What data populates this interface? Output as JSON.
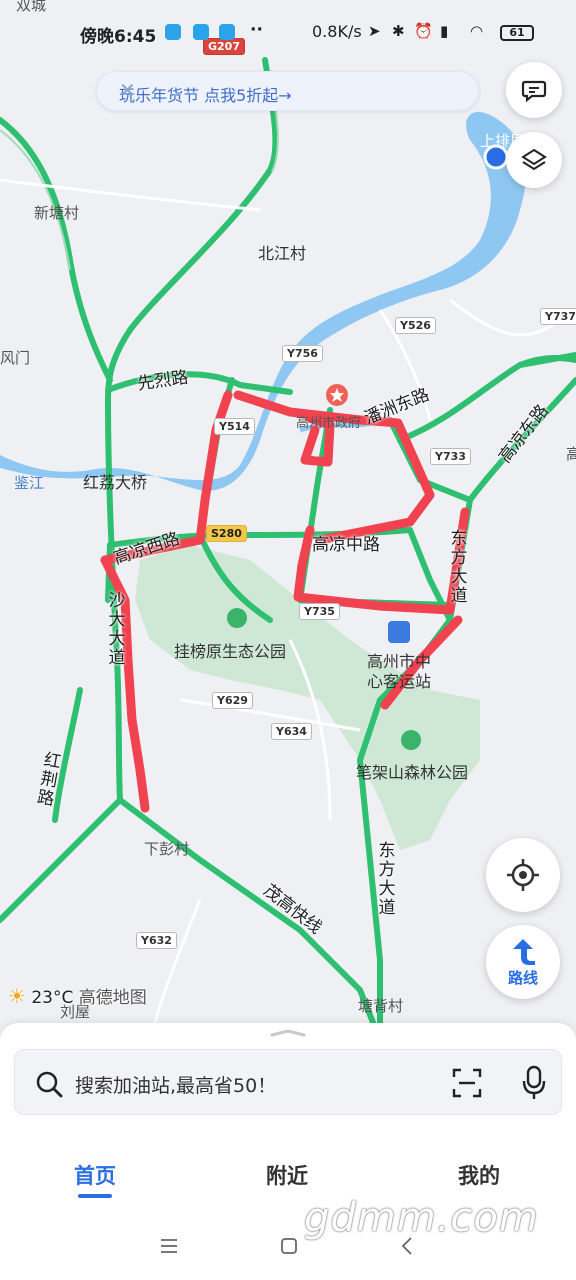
{
  "status_bar": {
    "time": "傍晚6:45",
    "dots": "··",
    "network_speed": "0.8K/s",
    "battery": "61"
  },
  "promo": {
    "text": "玩乐年货节 点我5折起→",
    "close": "✕"
  },
  "map": {
    "top_cut_label": "双城",
    "place_labels": {
      "xintang": "新塘村",
      "beijiang": "北江村",
      "fengmen": "风门",
      "jianjiang": "鉴江",
      "honglijiaqiao": "红荔大桥",
      "guabangyuan": "挂榜原生态公园",
      "gaozhou_bus_1": "高州市中",
      "gaozhou_bus_2": "心客运站",
      "bijiashan": "笔架山森林公园",
      "xiapeng": "下彭村",
      "liuwu": "刘屋",
      "tangbei": "塘背村",
      "shangpai": "上排尾",
      "gao_e": "高",
      "gaozhou_gov": "高州市政府",
      "gao_left": "高凉中路",
      "gao_right_zh": "高"
    },
    "road_labels": {
      "xianlie": "先烈路",
      "panzhou": "潘洲东路",
      "gaoliang_east": "高凉东路",
      "gaoliang_mid": "高凉中路",
      "gaoliang_west": "高凉西路",
      "maogao": "茂高快线",
      "dongfang_low": "东方大道",
      "dongfang_up": "东方大道",
      "hongjing": "红荆路",
      "west_ave": "沙大大道"
    },
    "route_shields": {
      "g207": "G207",
      "s280": "S280",
      "y526": "Y526",
      "y737": "Y737",
      "y756": "Y756",
      "y514": "Y514",
      "y733": "Y733",
      "y735": "Y735",
      "y629": "Y629",
      "y634": "Y634",
      "y632": "Y632"
    }
  },
  "buttons": {
    "route_label": "路线"
  },
  "weather": {
    "temp": "23°C",
    "brand": "高德地图"
  },
  "search": {
    "placeholder": "搜索加油站,最高省50！"
  },
  "tabs": [
    {
      "label": "首页",
      "active": true
    },
    {
      "label": "附近",
      "active": false
    },
    {
      "label": "我的",
      "active": false
    }
  ],
  "watermark": "gdmm.com",
  "colors": {
    "road_green": "#2fbf71",
    "river_blue": "#8ec8f2",
    "red_mark": "#f0424f",
    "accent_blue": "#2a6ee6",
    "park_green": "#cfe8d6"
  }
}
